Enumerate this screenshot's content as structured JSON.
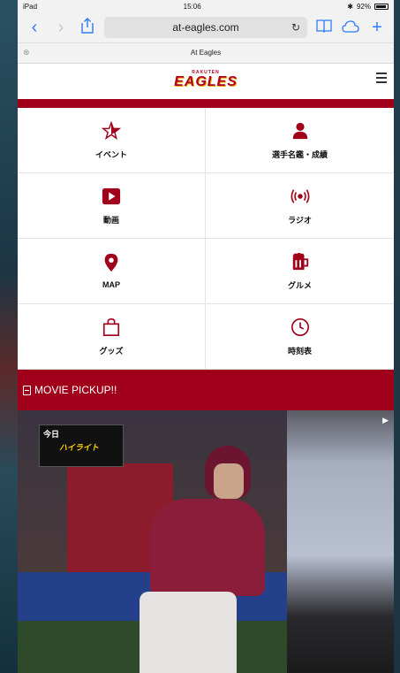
{
  "status": {
    "device": "iPad",
    "time": "15:06",
    "battery": "92%"
  },
  "browser": {
    "url": "at-eagles.com",
    "tab_title": "At Eagles"
  },
  "site": {
    "logo_small": "RAKUTEN",
    "logo_big": "EAGLES"
  },
  "menu": [
    {
      "label": "イベント",
      "icon": "star-icon"
    },
    {
      "label": "選手名鑑・成績",
      "icon": "player-icon"
    },
    {
      "label": "動画",
      "icon": "video-play-icon"
    },
    {
      "label": "ラジオ",
      "icon": "radio-icon"
    },
    {
      "label": "MAP",
      "icon": "map-pin-icon"
    },
    {
      "label": "グルメ",
      "icon": "beer-mug-icon"
    },
    {
      "label": "グッズ",
      "icon": "shopping-bag-icon"
    },
    {
      "label": "時刻表",
      "icon": "clock-icon"
    }
  ],
  "pickup": {
    "title": "MOVIE PICKUP!!",
    "video_overlay_today": "今日",
    "video_overlay_tag": "ハイライト"
  },
  "colors": {
    "brand_red": "#a0001a",
    "ios_blue": "#2e7cf6"
  }
}
